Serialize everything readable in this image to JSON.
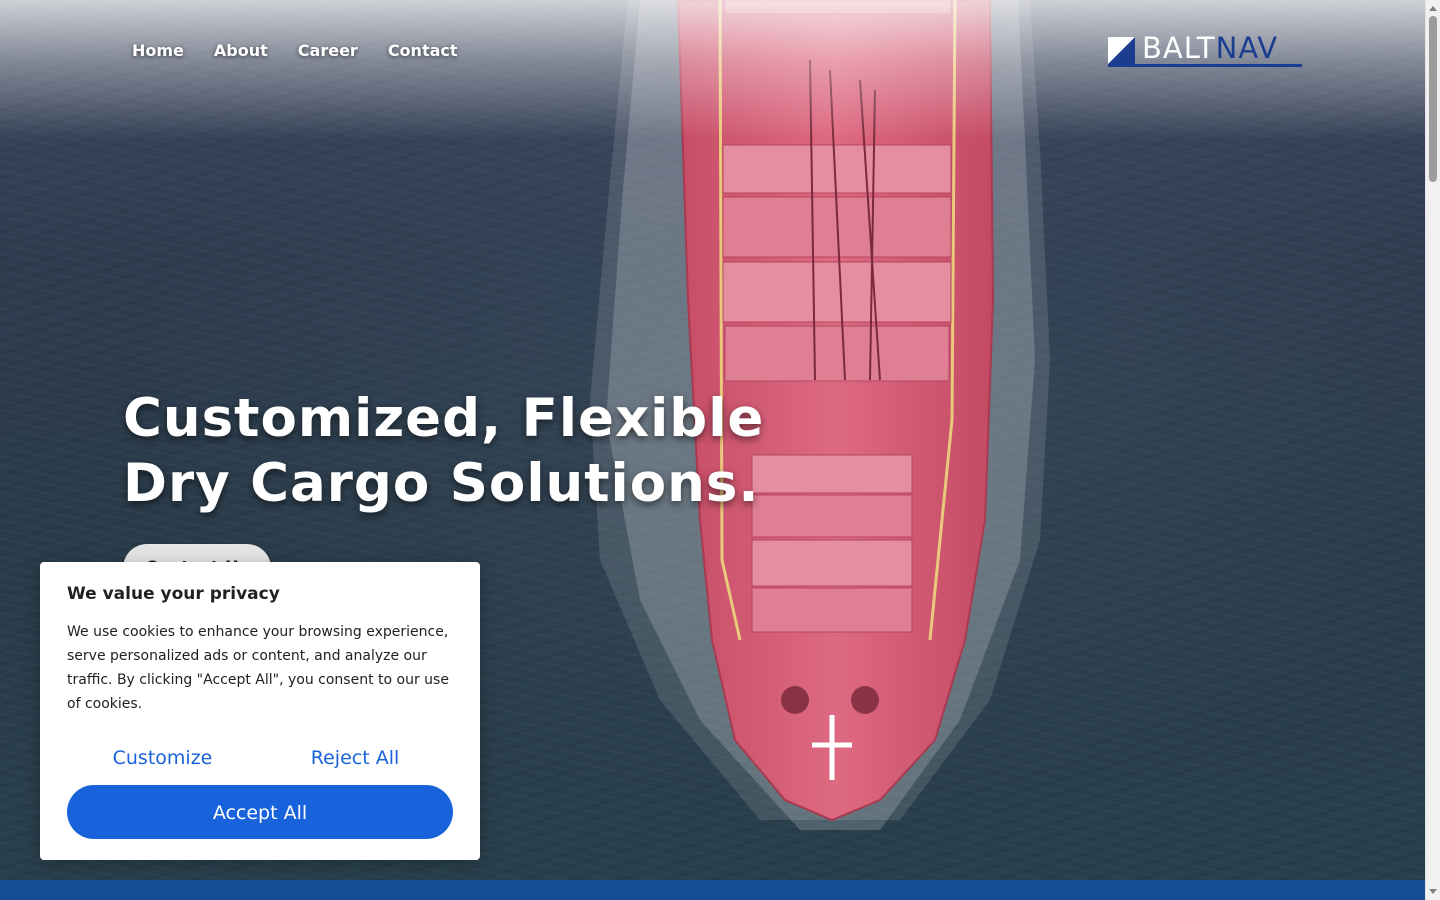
{
  "nav": {
    "items": [
      {
        "label": "Home"
      },
      {
        "label": "About"
      },
      {
        "label": "Career"
      },
      {
        "label": "Contact"
      }
    ]
  },
  "brand": {
    "part1": "BALT",
    "part2": "NAV",
    "color_primary": "#1a3d8f",
    "color_secondary": "#ffffff"
  },
  "hero": {
    "headline_line1": "Customized, Flexible",
    "headline_line2": "Dry Cargo Solutions.",
    "cta_label": "Contact Us"
  },
  "cookie_banner": {
    "title": "We value your privacy",
    "body": "We use cookies to enhance your browsing experience, serve personalized ads or content, and analyze our traffic. By clicking \"Accept All\", you consent to our use of cookies.",
    "customize_label": "Customize",
    "reject_label": "Reject All",
    "accept_label": "Accept All",
    "accent_color": "#1863dc"
  },
  "footer_band_color": "#164d94"
}
